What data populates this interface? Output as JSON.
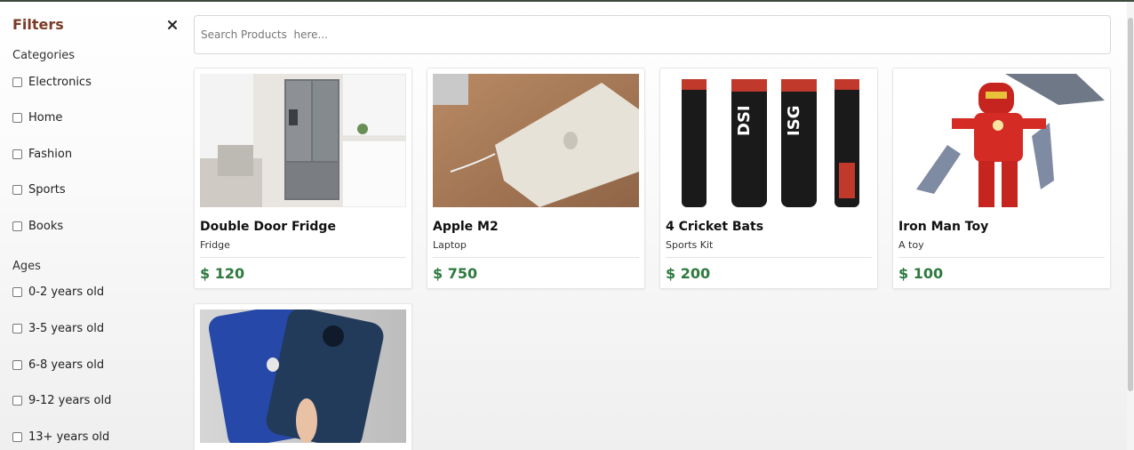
{
  "sidebar": {
    "title": "Filters",
    "categories_title": "Categories",
    "categories": [
      "Electronics",
      "Home",
      "Fashion",
      "Sports",
      "Books"
    ],
    "ages_title": "Ages",
    "ages": [
      "0-2 years old",
      "3-5 years old",
      "6-8 years old",
      "9-12 years old",
      "13+ years old"
    ]
  },
  "search": {
    "placeholder": "Search Products  here..."
  },
  "products": [
    {
      "name": "Double Door Fridge",
      "category": "Fridge",
      "price": "$ 120"
    },
    {
      "name": "Apple M2",
      "category": "Laptop",
      "price": "$ 750"
    },
    {
      "name": "4 Cricket Bats",
      "category": "Sports Kit",
      "price": "$ 200"
    },
    {
      "name": "Iron Man Toy",
      "category": "A toy",
      "price": "$ 100"
    },
    {
      "name": "",
      "category": "",
      "price": ""
    }
  ],
  "colors": {
    "title": "#7a3a26",
    "price": "#2e7a3f",
    "topbar": "#3d4a3d"
  }
}
